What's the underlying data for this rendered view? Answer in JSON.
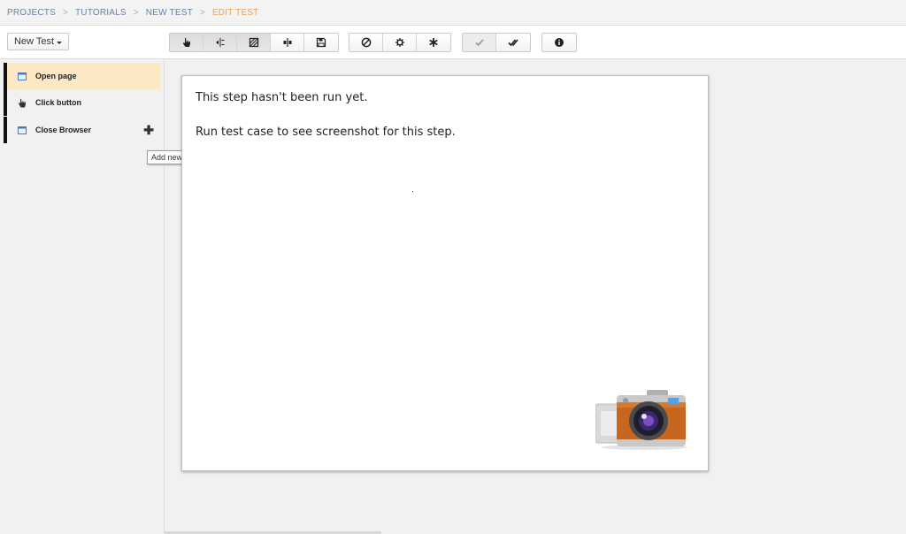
{
  "breadcrumb": [
    {
      "label": "PROJECTS"
    },
    {
      "label": "TUTORIALS"
    },
    {
      "label": "NEW TEST"
    },
    {
      "label": "EDIT TEST"
    }
  ],
  "toolbar": {
    "new_test_label": "New Test",
    "groups": [
      [
        "pointer-icon",
        "split-icon",
        "screenshot-icon",
        "align-icon",
        "save-icon"
      ],
      [
        "disable-icon",
        "settings-icon",
        "asterisk-icon"
      ],
      [
        "check-icon",
        "double-check-icon"
      ],
      [
        "info-icon"
      ]
    ]
  },
  "steps": [
    {
      "label": "Open page",
      "icon": "browser-window-icon",
      "selected": true
    },
    {
      "label": "Click button",
      "icon": "hand-pointer-icon",
      "selected": false
    },
    {
      "label": "Close Browser",
      "icon": "browser-window-icon",
      "selected": false
    }
  ],
  "tooltip": "Add new step before this step",
  "panel": {
    "line1": "This step hasn't been run yet.",
    "line2": "Run test case to see screenshot for this step."
  },
  "colors": {
    "breadcrumb_link": "#6a7fa6",
    "breadcrumb_active": "#f0a050",
    "selected_step": "#fde8c4",
    "step_marker": "#111111"
  }
}
